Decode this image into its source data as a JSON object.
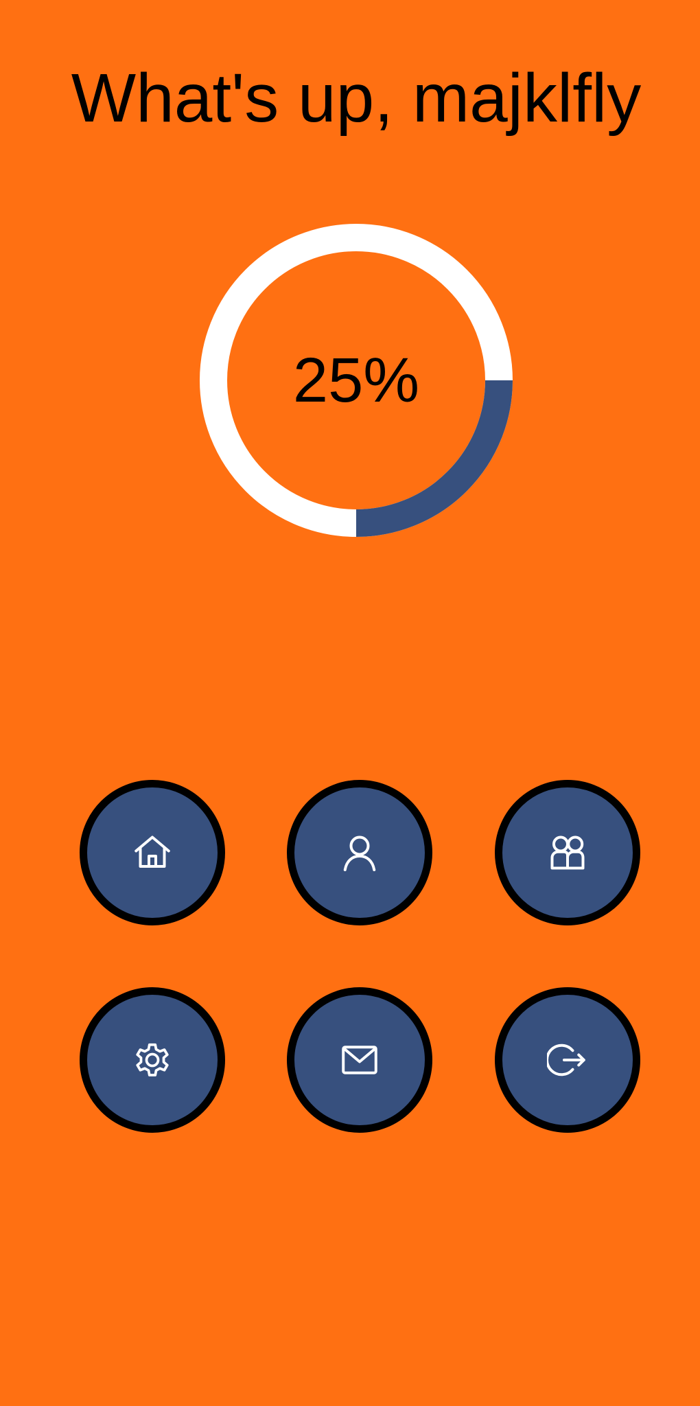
{
  "header": {
    "greeting": "What's up, majklfly"
  },
  "progress": {
    "label": "25%",
    "value": 0.25,
    "ring_color": "#FFFFFF",
    "fill_color": "#37507E"
  },
  "nav": {
    "buttons": [
      {
        "name": "home",
        "icon": "home-icon"
      },
      {
        "name": "profile",
        "icon": "user-icon"
      },
      {
        "name": "friends",
        "icon": "users-icon"
      },
      {
        "name": "settings",
        "icon": "gear-icon"
      },
      {
        "name": "messages",
        "icon": "mail-icon"
      },
      {
        "name": "logout",
        "icon": "logout-icon"
      }
    ]
  },
  "colors": {
    "background": "#FF7012",
    "button": "#37507E",
    "button_border": "#000000",
    "icon": "#FFFFFF"
  }
}
